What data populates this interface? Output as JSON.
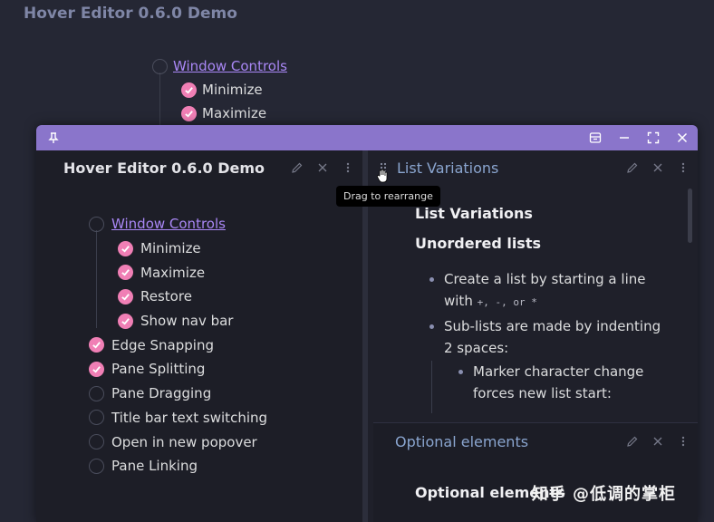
{
  "background": {
    "title": "Hover Editor 0.6.0 Demo",
    "list": [
      {
        "label": "Window Controls",
        "checked": false,
        "link": true
      },
      {
        "label": "Minimize",
        "checked": true
      },
      {
        "label": "Maximize",
        "checked": true
      }
    ]
  },
  "popover": {
    "titlebar_color": "#8a75cb",
    "left_pane": {
      "title": "Hover Editor 0.6.0 Demo",
      "items": [
        {
          "label": "Window Controls",
          "checked": false,
          "link": true,
          "indent": 0
        },
        {
          "label": "Minimize",
          "checked": true,
          "indent": 1
        },
        {
          "label": "Maximize",
          "checked": true,
          "indent": 1
        },
        {
          "label": "Restore",
          "checked": true,
          "indent": 1
        },
        {
          "label": "Show nav bar",
          "checked": true,
          "indent": 1
        },
        {
          "label": "Edge Snapping",
          "checked": true,
          "indent": 0
        },
        {
          "label": "Pane Splitting",
          "checked": true,
          "indent": 0
        },
        {
          "label": "Pane Dragging",
          "checked": false,
          "indent": 0
        },
        {
          "label": "Title bar text switching",
          "checked": false,
          "indent": 0
        },
        {
          "label": "Open in new popover",
          "checked": false,
          "indent": 0
        },
        {
          "label": "Pane Linking",
          "checked": false,
          "indent": 0
        }
      ]
    },
    "right_pane": {
      "title": "List Variations",
      "heading1": "List Variations",
      "heading2": "Unordered lists",
      "bullet1a": "Create a list by starting a line",
      "bullet1b_pre": "with ",
      "bullet1b_codes": "+, -, or *",
      "bullet2a": "Sub-lists are made by indenting",
      "bullet2b": "2 spaces:",
      "sub1a": "Marker character change",
      "sub1b": "forces new list start:"
    },
    "sub_pane": {
      "title": "Optional elements",
      "heading": "Optional elements",
      "watermark": "知乎 @低调的掌柜"
    }
  },
  "tooltip": "Drag to rearrange",
  "accent": "#f07fb5",
  "link_color": "#a987f5"
}
